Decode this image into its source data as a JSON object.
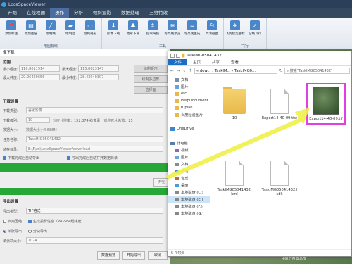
{
  "app": {
    "title": "LocaSpaceViewer",
    "menu": [
      "开始",
      "在线地图",
      "操作",
      "分析",
      "倾斜摄影",
      "数据处理",
      "三维特效"
    ],
    "active_menu": 2
  },
  "ribbon": {
    "groups": [
      {
        "title": "地图标绘",
        "buttons": [
          {
            "label": "添加标注",
            "icon": "📍"
          },
          {
            "label": "添加图层",
            "icon": "▤"
          },
          {
            "label": "绘制线",
            "icon": "╱"
          },
          {
            "label": "绘制面",
            "icon": "▰"
          },
          {
            "label": "绘制矩形",
            "icon": "▭"
          }
        ]
      },
      {
        "title": "工具",
        "buttons": [
          {
            "label": "影像下载",
            "icon": "⬇"
          },
          {
            "label": "地形下载",
            "icon": "⛰"
          },
          {
            "label": "提取海拔",
            "icon": "↕"
          },
          {
            "label": "等高线预览",
            "icon": "≋"
          },
          {
            "label": "等高线生成",
            "icon": "≈"
          },
          {
            "label": "高清截图",
            "icon": "⎙"
          }
        ]
      },
      {
        "title": "飞行",
        "buttons": [
          {
            "label": "飞到指定坐标",
            "icon": "✈"
          },
          {
            "label": "沿线飞行",
            "icon": "➚"
          }
        ]
      }
    ]
  },
  "dialog": {
    "title": "像下载",
    "range": {
      "heading": "范围",
      "min_lon_label": "最小经度:",
      "min_lon": "116.8011914",
      "max_lon_label": "最大经度:",
      "max_lon": "115.8623147",
      "max_lat_label": "最大纬度:",
      "max_lat": "29.26429656",
      "min_lat_label": "最小纬度:",
      "min_lat": "28.43940307",
      "btn_draw_rect": "绘制矩形",
      "btn_draw_poly": "绘制多边形",
      "btn_select": "选择面"
    },
    "download": {
      "heading": "下载设置",
      "type_label": "下载类型:",
      "type_value": "谷歌影像",
      "level_label": "下载级别:",
      "level_value": "10",
      "level_info": "对应分辨率：152.874米/像素，对应瓦片总数：25",
      "size_label": "数据大小:",
      "size_value": "数据大小小4.688M",
      "task_label": "任务名称:",
      "task_value": "TaskIMG05041432",
      "path_label": "储存目录:",
      "path_value": "E:\\F\\zx\\LocaSpaceViewer\\download",
      "opt_auto_export": "下载完成后自动导出",
      "opt_open_dir": "导出完成后自动打开数据目录",
      "btn_start": "开始"
    },
    "export": {
      "heading": "导出设置",
      "type_label": "导出类型:",
      "type_value": "TIF格式",
      "opt_compress": "启用压缩",
      "opt_projection": "生成投影信息（WGS84经纬度）",
      "single_label": "单张导出",
      "tile_label": "分块导出",
      "tile_size_label": "单张块大小:",
      "tile_size_value": "1024",
      "btn_preview": "数据预览",
      "btn_export": "开始导出",
      "btn_cancel": "取消"
    }
  },
  "explorer": {
    "title": "TaskIMG05041432",
    "tabs": [
      "文件",
      "主页",
      "共享",
      "查看"
    ],
    "active_tab": 0,
    "path": "« dow... › TaskIM... › TaskIMG0...",
    "search_placeholder": "搜索\"TaskIMG05041432\"",
    "nav": [
      {
        "label": "文档",
        "icon": "doc"
      },
      {
        "label": "图片",
        "icon": "pic"
      },
      {
        "label": "etc",
        "icon": "folder"
      },
      {
        "label": "HelpDocument",
        "icon": "folder"
      },
      {
        "label": "tupian",
        "icon": "folder"
      },
      {
        "label": "百度经验图片",
        "icon": "folder"
      },
      {
        "label": "",
        "icon": ""
      },
      {
        "label": "OneDrive",
        "icon": "cloud"
      },
      {
        "label": "",
        "icon": ""
      },
      {
        "label": "此电脑",
        "icon": "pc"
      },
      {
        "label": "视频",
        "icon": "video"
      },
      {
        "label": "图片",
        "icon": "pic"
      },
      {
        "label": "文档",
        "icon": "doc"
      },
      {
        "label": "下载",
        "icon": "down"
      },
      {
        "label": "音乐",
        "icon": "music"
      },
      {
        "label": "桌面",
        "icon": "desk"
      },
      {
        "label": "本地磁盘 (C:)",
        "icon": "drive"
      },
      {
        "label": "本地磁盘 (E:)",
        "icon": "drive"
      },
      {
        "label": "本地磁盘 (F:)",
        "icon": "drive"
      },
      {
        "label": "本地磁盘 (G:)",
        "icon": "drive"
      }
    ],
    "selected_nav": 17,
    "files": [
      {
        "name": "10",
        "kind": "folder"
      },
      {
        "name": "Export14-40-09.tfw",
        "kind": "doc"
      },
      {
        "name": "Export14-40-09.tif",
        "kind": "image"
      },
      {
        "name": "TaskIMG05041432.kml",
        "kind": "doc"
      },
      {
        "name": "TaskIMG05041432.lsdk",
        "kind": "doc"
      }
    ],
    "status": "5 个项目"
  },
  "overlay": {
    "watermark": "Baidu经验",
    "coords": "中国 江西 瑞昌市"
  },
  "colors": {
    "accent": "#1a6fc4",
    "progress": "#27a737",
    "highlight": "#e040e0",
    "arrow": "#f0f04a"
  }
}
